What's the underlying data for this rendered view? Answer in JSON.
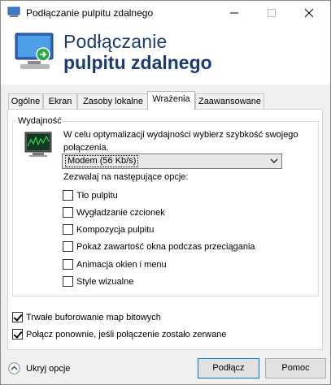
{
  "window": {
    "title": "Podłączanie pulpitu zdalnego"
  },
  "banner": {
    "line1": "Podłączanie",
    "line2": "pulpitu zdalnego"
  },
  "tabs": [
    {
      "label": "Ogólne",
      "active": false
    },
    {
      "label": "Ekran",
      "active": false
    },
    {
      "label": "Zasoby lokalne",
      "active": false
    },
    {
      "label": "Wrażenia",
      "active": true
    },
    {
      "label": "Zaawansowane",
      "active": false
    }
  ],
  "performance": {
    "group_label": "Wydajność",
    "description": "W celu optymalizacji wydajności wybierz szybkość swojego połączenia.",
    "speed_selected": "Modem (56 Kb/s)",
    "allow_label": "Zezwalaj na następujące opcje:",
    "options": [
      {
        "label": "Tło pulpitu",
        "checked": false
      },
      {
        "label": "Wygładzanie czcionek",
        "checked": false
      },
      {
        "label": "Kompozycja pulpitu",
        "checked": false
      },
      {
        "label": "Pokaż zawartość okna podczas przeciągania",
        "checked": false
      },
      {
        "label": "Animacja okien i menu",
        "checked": false
      },
      {
        "label": "Style wizualne",
        "checked": false
      }
    ]
  },
  "extra_options": [
    {
      "label": "Trwałe buforowanie map bitowych",
      "checked": true
    },
    {
      "label": "Połącz ponownie, jeśli połączenie zostało zerwane",
      "checked": true
    }
  ],
  "footer": {
    "hide_options_label": "Ukryj opcje",
    "connect_label": "Podłącz",
    "help_label": "Pomoc"
  },
  "colors": {
    "banner_text": "#1a3c72",
    "default_button_border": "#0078d7"
  }
}
